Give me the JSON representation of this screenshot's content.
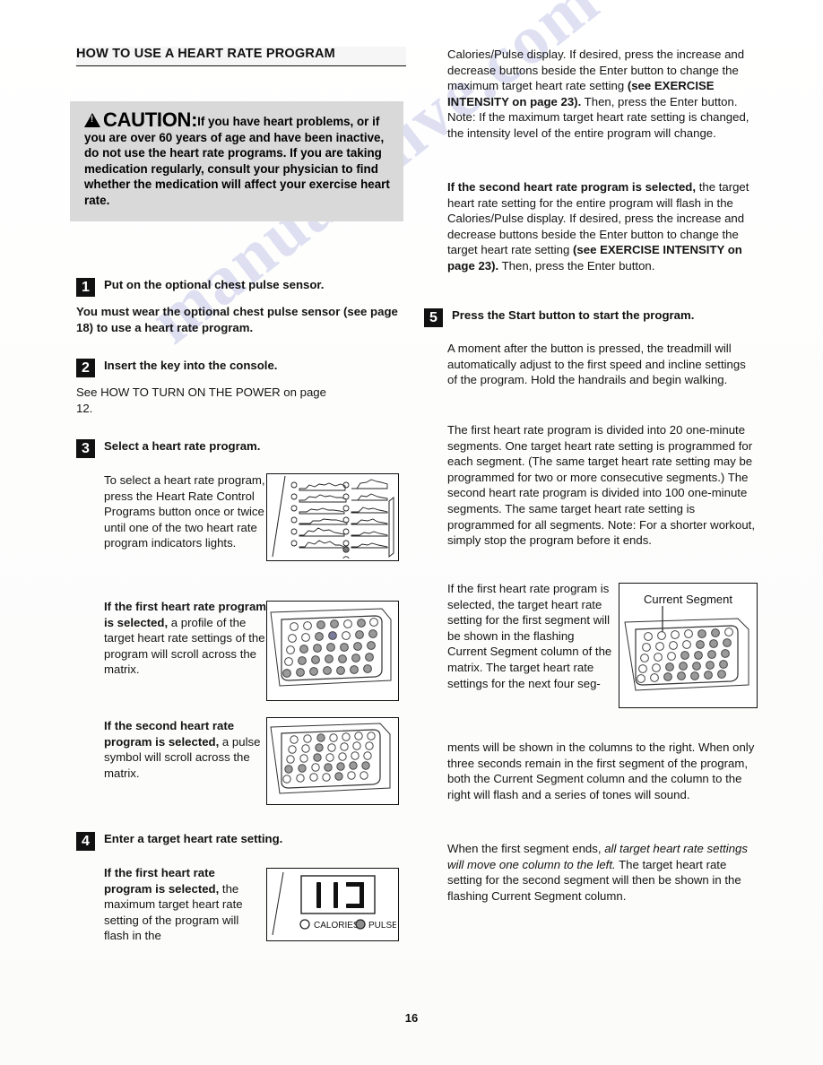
{
  "document": {
    "title": "HOW TO USE A HEART RATE PROGRAM",
    "page_number": "16",
    "watermark": "manualshive.com"
  },
  "caution": {
    "label": "CAUTION:",
    "text": "If you have heart problems, or if you are over 60 years of age and have been inactive, do not use the heart rate programs. If you are taking medication regularly, consult your physician to find whether the medication will affect your exercise heart rate."
  },
  "steps": [
    {
      "number": "1",
      "title": "Put on the optional chest pulse sensor.",
      "body": "You must wear the optional chest pulse sensor (see page 18) to use a heart rate program."
    },
    {
      "number": "2",
      "title": "Insert the key into the console.",
      "body": "See HOW TO TURN ON THE POWER on page 12."
    },
    {
      "number": "3",
      "title": "Select a heart rate program.",
      "body": "To select a heart rate program, press the Heart Rate Control Programs button once or twice until one of the two heart rate program indicators lights.",
      "body2_bold": "If the first heart rate program is selected,",
      "body2_rest": " a profile of the target heart rate settings of the program will scroll across the matrix.",
      "body3_bold": "If the second heart rate program is selected,",
      "body3_rest": " a pulse symbol will scroll across the matrix."
    },
    {
      "number": "4",
      "title": "Enter a target heart rate setting.",
      "body_bold": "If the first heart rate program is selected,",
      "body_rest": " the maximum target heart rate setting of the program will flash in the"
    },
    {
      "number": "5",
      "title": "Press the Start button to start the program.",
      "body": "A moment after the button is pressed, the treadmill will automatically adjust to the first speed and incline settings of the program. Hold the handrails and begin walking."
    }
  ],
  "right_column": {
    "para1_a": "Calories/Pulse display. If desired, press the increase and decrease buttons beside the Enter button to change the maximum target heart rate setting ",
    "para1_bold": "(see EXERCISE INTENSITY on page 23).",
    "para1_b": " Then, press the Enter button. Note: If the maximum target heart rate setting is changed, the intensity level of the entire program will change.",
    "para2_bold": "If the second heart rate program is selected,",
    "para2_a": " the target heart rate setting for the entire program will flash in the Calories/Pulse display. If desired, press the increase and decrease buttons beside the Enter button to change the target heart rate setting ",
    "para2_bold2": "(see EXERCISE INTENSITY on page 23).",
    "para2_b": " Then, press the Enter button.",
    "para3": "The first heart rate program is divided into 20 one-minute segments. One target heart rate setting is programmed for each segment. (The same target heart rate setting may be programmed for two or more consecutive segments.) The second heart rate program is divided into 100 one-minute segments. The same target heart rate setting is programmed for all segments. Note: For a shorter workout, simply stop the program before it ends.",
    "para4_wrap": "If the first heart rate program is selected, the target heart rate setting for the first segment will be shown in the flashing Current Segment column of the matrix. The target heart rate settings for the next four seg-",
    "para4_rest": "ments will be shown in the columns to the right. When only three seconds remain in the first segment of the program, both the Current Segment column and the column to the right will flash and a series of tones will sound.",
    "para5_a": "When the first segment ends, ",
    "para5_italic": "all target heart rate settings will move one column to the left.",
    "para5_b": " The target heart rate setting for the second segment will then be shown in the flashing Current Segment column."
  },
  "figures": {
    "program_chart": {
      "name": "console program profile chart"
    },
    "matrix_profile": {
      "name": "matrix showing scrolling heart rate profile"
    },
    "matrix_pulse": {
      "name": "matrix showing pulse symbol"
    },
    "led_display": {
      "value": "110",
      "calories_label": "CALORIES",
      "pulse_label": "PULSE"
    },
    "current_segment": {
      "label": "Current Segment"
    }
  }
}
